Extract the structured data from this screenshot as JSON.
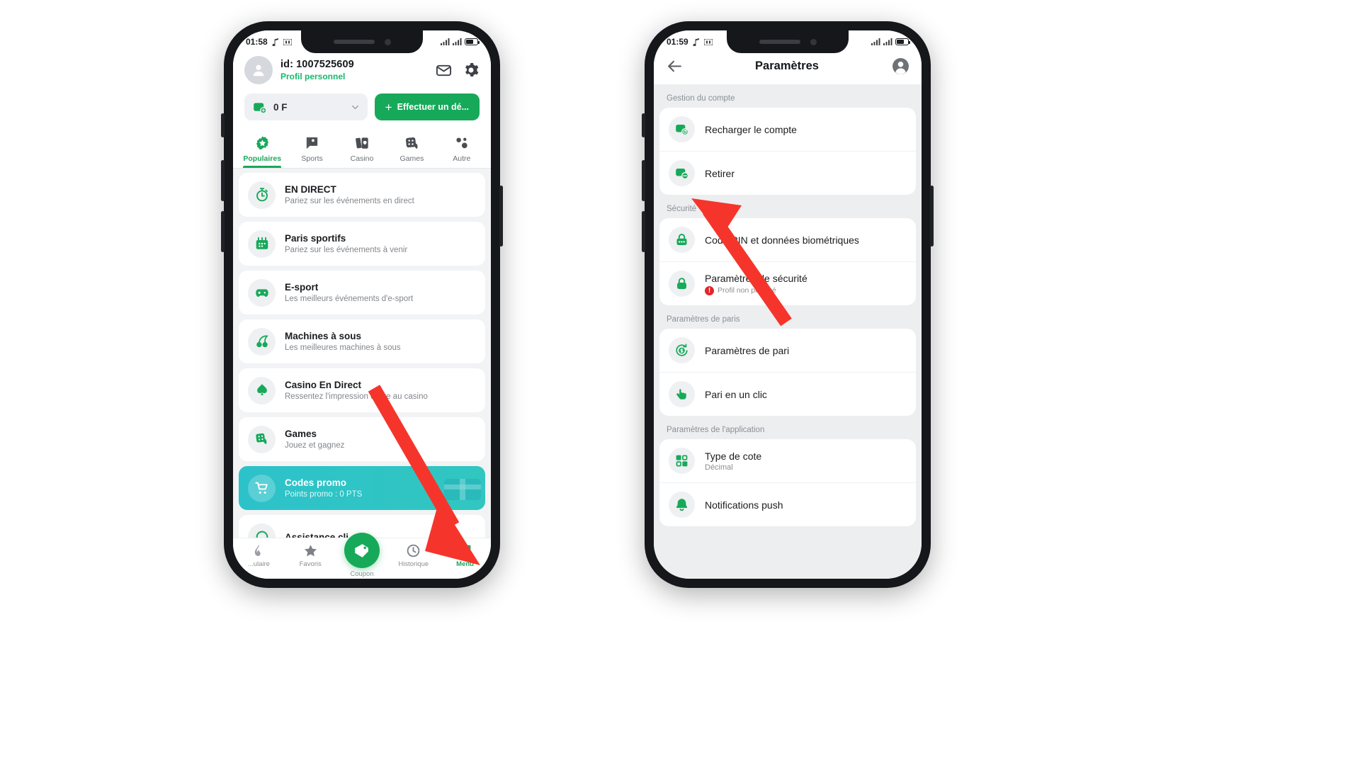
{
  "left_phone": {
    "status_bar": {
      "time": "01:58",
      "icons": [
        "music-note-icon",
        "nfc-icon",
        "signal-icon",
        "signal-icon",
        "battery-icon"
      ]
    },
    "header": {
      "avatar": "person-avatar",
      "id_label": "id: 1007525609",
      "profile_type": "Profil personnel",
      "mail_icon": "mail-icon",
      "settings_icon": "gear-icon",
      "balance": "0 F",
      "wallet_icon": "wallet-icon",
      "chevron_icon": "chevron-down-icon",
      "deposit_label": "Effectuer un dé...",
      "deposit_plus": "+"
    },
    "tabs": [
      {
        "label": "Populaires",
        "icon": "star-badge-icon",
        "active": true
      },
      {
        "label": "Sports",
        "icon": "soccer-ball-icon",
        "active": false
      },
      {
        "label": "Casino",
        "icon": "playing-cards-icon",
        "active": false
      },
      {
        "label": "Games",
        "icon": "dice-icon",
        "active": false
      },
      {
        "label": "Autre",
        "icon": "more-dots-icon",
        "active": false
      }
    ],
    "menu_items": [
      {
        "title": "EN DIRECT",
        "subtitle": "Pariez sur les événements en direct",
        "icon": "stopwatch-icon",
        "promo": false
      },
      {
        "title": "Paris sportifs",
        "subtitle": "Pariez sur les événements à venir",
        "icon": "calendar-icon",
        "promo": false
      },
      {
        "title": "E-sport",
        "subtitle": "Les meilleurs événements d'e-sport",
        "icon": "gamepad-icon",
        "promo": false
      },
      {
        "title": "Machines à sous",
        "subtitle": "Les meilleures machines à sous",
        "icon": "cherry-icon",
        "promo": false
      },
      {
        "title": "Casino En Direct",
        "subtitle": "Ressentez l'impression d'être au casino",
        "icon": "spade-icon",
        "promo": false
      },
      {
        "title": "Games",
        "subtitle": "Jouez et gagnez",
        "icon": "dice-icon",
        "promo": false
      },
      {
        "title": "Codes promo",
        "subtitle": "Points promo : 0 PTS",
        "icon": "promo-cart-icon",
        "promo": true
      },
      {
        "title": "Assistance cli...",
        "subtitle": "",
        "icon": "headset-icon",
        "promo": false
      }
    ],
    "bottom_nav": [
      {
        "label": "...ulaire",
        "icon": "fire-icon",
        "active": false
      },
      {
        "label": "Favoris",
        "icon": "star-icon",
        "active": false
      },
      {
        "label": "Coupon",
        "icon": "ticket-icon",
        "active": false,
        "fab": true
      },
      {
        "label": "Historique",
        "icon": "clock-icon",
        "active": false
      },
      {
        "label": "Menu",
        "icon": "grid-icon",
        "active": true
      }
    ]
  },
  "right_phone": {
    "status_bar": {
      "time": "01:59"
    },
    "header": {
      "back_icon": "arrow-left-icon",
      "title": "Paramètres",
      "account_icon": "person-circle-icon"
    },
    "sections": [
      {
        "label": "Gestion du compte",
        "rows": [
          {
            "title": "Recharger le compte",
            "subtitle": "",
            "icon": "wallet-add-icon",
            "warning": ""
          },
          {
            "title": "Retirer",
            "subtitle": "",
            "icon": "wallet-minus-icon",
            "warning": ""
          }
        ]
      },
      {
        "label": "Sécurité",
        "rows": [
          {
            "title": "Code PIN et données biométriques",
            "subtitle": "",
            "icon": "pin-lock-icon",
            "warning": ""
          },
          {
            "title": "Paramètres de sécurité",
            "subtitle": "",
            "icon": "lock-icon",
            "warning": "Profil non protégé"
          }
        ]
      },
      {
        "label": "Paramètres de paris",
        "rows": [
          {
            "title": "Paramètres de pari",
            "subtitle": "",
            "icon": "dollar-refresh-icon",
            "warning": ""
          },
          {
            "title": "Pari en un clic",
            "subtitle": "",
            "icon": "tap-hand-icon",
            "warning": ""
          }
        ]
      },
      {
        "label": "Paramètres de l'application",
        "rows": [
          {
            "title": "Type de cote",
            "subtitle": "Décimal",
            "icon": "grid-squares-icon",
            "warning": ""
          },
          {
            "title": "Notifications push",
            "subtitle": "",
            "icon": "bell-icon",
            "warning": ""
          }
        ]
      }
    ]
  },
  "annotations": {
    "arrow_color": "#f5352b",
    "arrow_left_target": "menu-bottom-nav-item",
    "arrow_right_target": "retirer-row"
  },
  "colors": {
    "brand_green": "#17a95a",
    "promo_teal": "#2dc2ca",
    "warning_red": "#e8232a",
    "arrow_red": "#f5352b"
  }
}
